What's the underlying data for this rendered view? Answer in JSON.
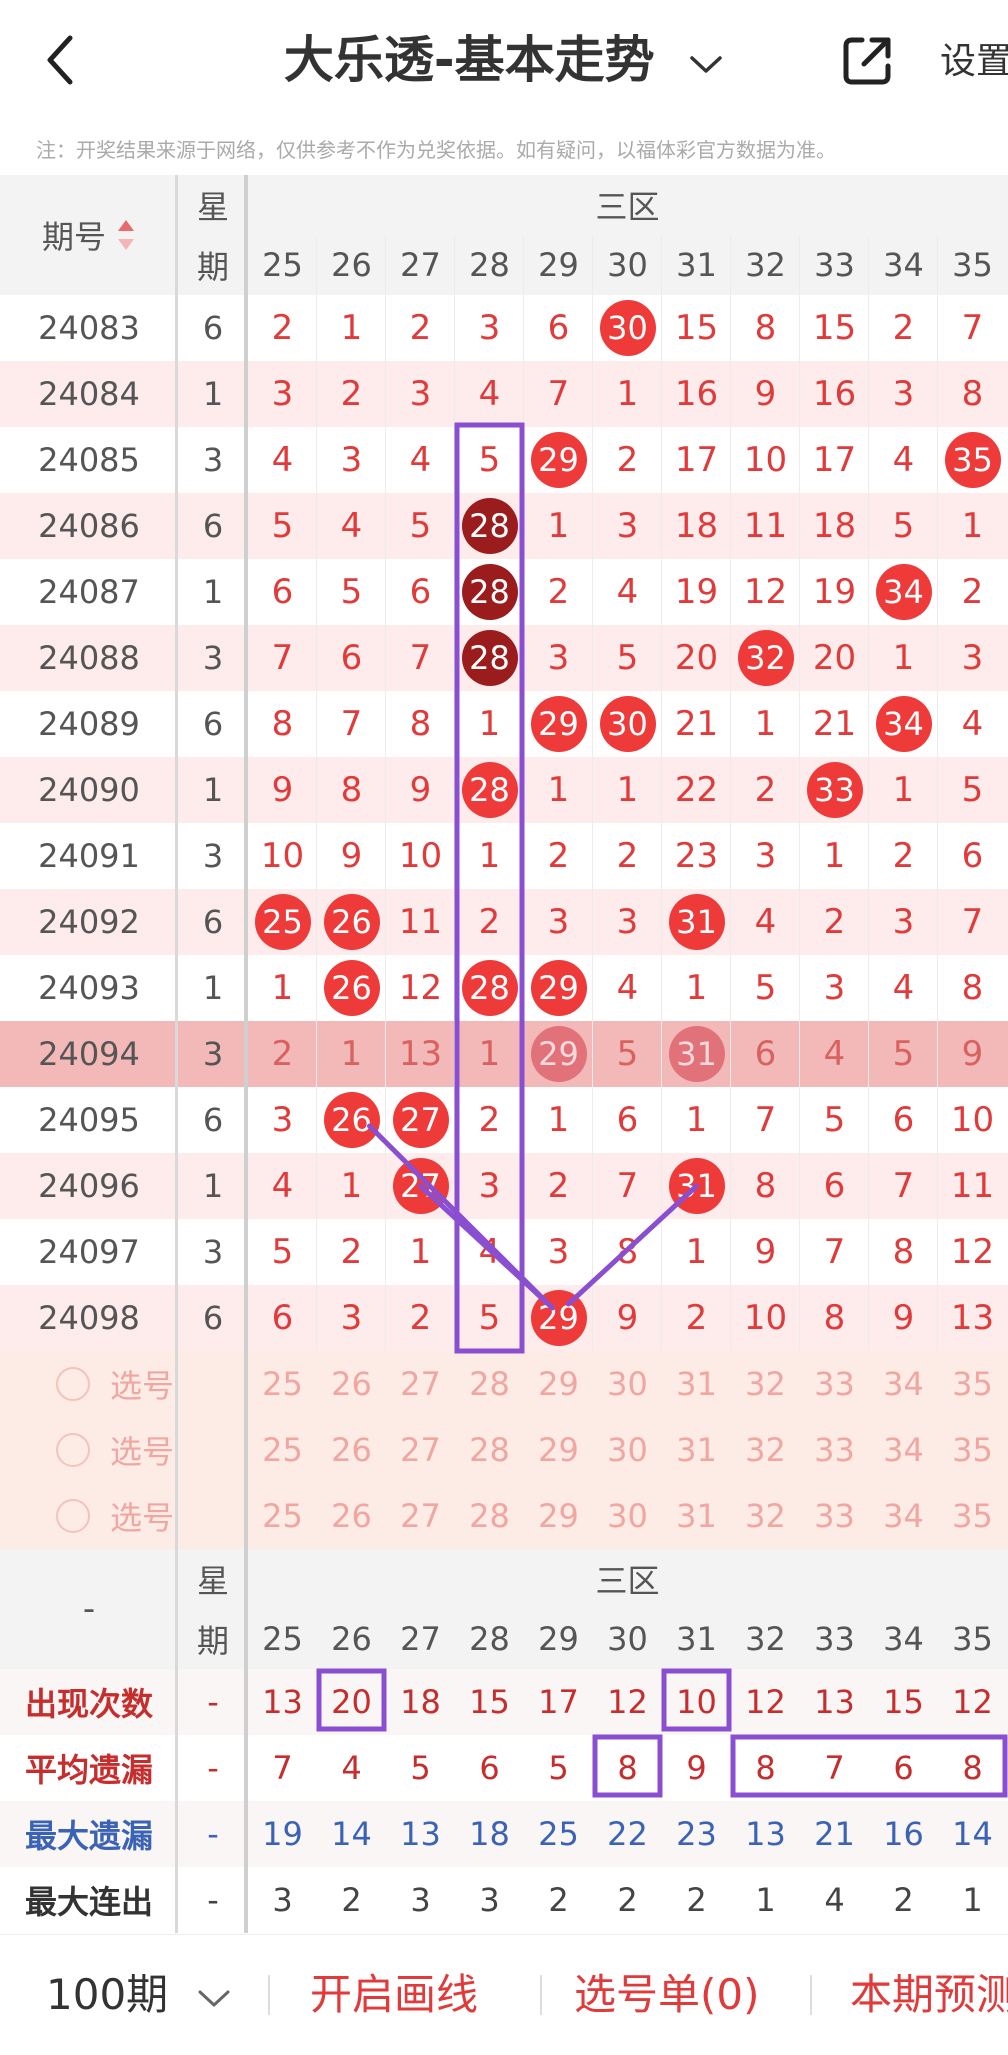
{
  "header": {
    "title": "大乐透-基本走势",
    "settings_label": "设置"
  },
  "notice": "注：开奖结果来源于网络，仅供参考不作为兑奖依据。如有疑问，以福体彩官方数据为准。",
  "table": {
    "period_header": "期号",
    "week_header_top": "星",
    "week_header_bottom": "期",
    "zone_label": "三区",
    "columns": [
      "25",
      "26",
      "27",
      "28",
      "29",
      "30",
      "31",
      "32",
      "33",
      "34",
      "35"
    ],
    "rows": [
      {
        "period": "24083",
        "week": "6",
        "values": [
          "2",
          "1",
          "2",
          "3",
          "6",
          "30",
          "15",
          "8",
          "15",
          "2",
          "7"
        ],
        "hits": [
          5
        ]
      },
      {
        "period": "24084",
        "week": "1",
        "values": [
          "3",
          "2",
          "3",
          "4",
          "7",
          "1",
          "16",
          "9",
          "16",
          "3",
          "8"
        ],
        "hits": []
      },
      {
        "period": "24085",
        "week": "3",
        "values": [
          "4",
          "3",
          "4",
          "5",
          "29",
          "2",
          "17",
          "10",
          "17",
          "4",
          "35"
        ],
        "hits": [
          4,
          10
        ]
      },
      {
        "period": "24086",
        "week": "6",
        "values": [
          "5",
          "4",
          "5",
          "28",
          "1",
          "3",
          "18",
          "11",
          "18",
          "5",
          "1"
        ],
        "hits": [
          3
        ],
        "dark": [
          3
        ]
      },
      {
        "period": "24087",
        "week": "1",
        "values": [
          "6",
          "5",
          "6",
          "28",
          "2",
          "4",
          "19",
          "12",
          "19",
          "34",
          "2"
        ],
        "hits": [
          3,
          9
        ],
        "dark": [
          3
        ]
      },
      {
        "period": "24088",
        "week": "3",
        "values": [
          "7",
          "6",
          "7",
          "28",
          "3",
          "5",
          "20",
          "32",
          "20",
          "1",
          "3"
        ],
        "hits": [
          3,
          7
        ],
        "dark": [
          3
        ]
      },
      {
        "period": "24089",
        "week": "6",
        "values": [
          "8",
          "7",
          "8",
          "1",
          "29",
          "30",
          "21",
          "1",
          "21",
          "34",
          "4"
        ],
        "hits": [
          4,
          5,
          9
        ]
      },
      {
        "period": "24090",
        "week": "1",
        "values": [
          "9",
          "8",
          "9",
          "28",
          "1",
          "1",
          "22",
          "2",
          "33",
          "1",
          "5"
        ],
        "hits": [
          3,
          8
        ]
      },
      {
        "period": "24091",
        "week": "3",
        "values": [
          "10",
          "9",
          "10",
          "1",
          "2",
          "2",
          "23",
          "3",
          "1",
          "2",
          "6"
        ],
        "hits": []
      },
      {
        "period": "24092",
        "week": "6",
        "values": [
          "25",
          "26",
          "11",
          "2",
          "3",
          "3",
          "31",
          "4",
          "2",
          "3",
          "7"
        ],
        "hits": [
          0,
          1,
          6
        ]
      },
      {
        "period": "24093",
        "week": "1",
        "values": [
          "1",
          "26",
          "12",
          "28",
          "29",
          "4",
          "1",
          "5",
          "3",
          "4",
          "8"
        ],
        "hits": [
          1,
          3,
          4
        ]
      },
      {
        "period": "24094",
        "week": "3",
        "values": [
          "2",
          "1",
          "13",
          "1",
          "29",
          "5",
          "31",
          "6",
          "4",
          "5",
          "9"
        ],
        "hits": [
          4,
          6
        ],
        "highlight": true
      },
      {
        "period": "24095",
        "week": "6",
        "values": [
          "3",
          "26",
          "27",
          "2",
          "1",
          "6",
          "1",
          "7",
          "5",
          "6",
          "10"
        ],
        "hits": [
          1,
          2
        ]
      },
      {
        "period": "24096",
        "week": "1",
        "values": [
          "4",
          "1",
          "27",
          "3",
          "2",
          "7",
          "31",
          "8",
          "6",
          "7",
          "11"
        ],
        "hits": [
          2,
          6
        ]
      },
      {
        "period": "24097",
        "week": "3",
        "values": [
          "5",
          "2",
          "1",
          "4",
          "3",
          "8",
          "1",
          "9",
          "7",
          "8",
          "12"
        ],
        "hits": []
      },
      {
        "period": "24098",
        "week": "6",
        "values": [
          "6",
          "3",
          "2",
          "5",
          "29",
          "9",
          "2",
          "10",
          "8",
          "9",
          "13"
        ],
        "hits": [
          4
        ]
      }
    ],
    "pick_label": "选号",
    "pick_rows": 3
  },
  "stats": {
    "dash": "-",
    "week_header_top": "星",
    "week_header_bottom": "期",
    "zone_label": "三区",
    "rows": [
      {
        "label": "出现次数",
        "week": "-",
        "values": [
          "13",
          "20",
          "18",
          "15",
          "17",
          "12",
          "10",
          "12",
          "13",
          "15",
          "12"
        ],
        "color": "red"
      },
      {
        "label": "平均遗漏",
        "week": "-",
        "values": [
          "7",
          "4",
          "5",
          "6",
          "5",
          "8",
          "9",
          "8",
          "7",
          "6",
          "8"
        ],
        "color": "red"
      },
      {
        "label": "最大遗漏",
        "week": "-",
        "values": [
          "19",
          "14",
          "13",
          "18",
          "25",
          "22",
          "23",
          "13",
          "21",
          "16",
          "14"
        ],
        "color": "blue"
      },
      {
        "label": "最大连出",
        "week": "-",
        "values": [
          "3",
          "2",
          "3",
          "3",
          "2",
          "2",
          "2",
          "1",
          "4",
          "2",
          "1"
        ],
        "color": "gray"
      }
    ]
  },
  "bottom": {
    "periods_label": "100期",
    "draw_lines_label": "开启画线",
    "pick_list_label": "选号单(0)",
    "predict_label": "本期预测"
  },
  "colors": {
    "ball": "#ef3a3a",
    "ball_dark": "#9b1c1c",
    "annotation": "#8a4fd0",
    "highlight_row": "#f3b8b8",
    "zebra": "#fdeceb",
    "pick_area": "#fdebe6"
  }
}
